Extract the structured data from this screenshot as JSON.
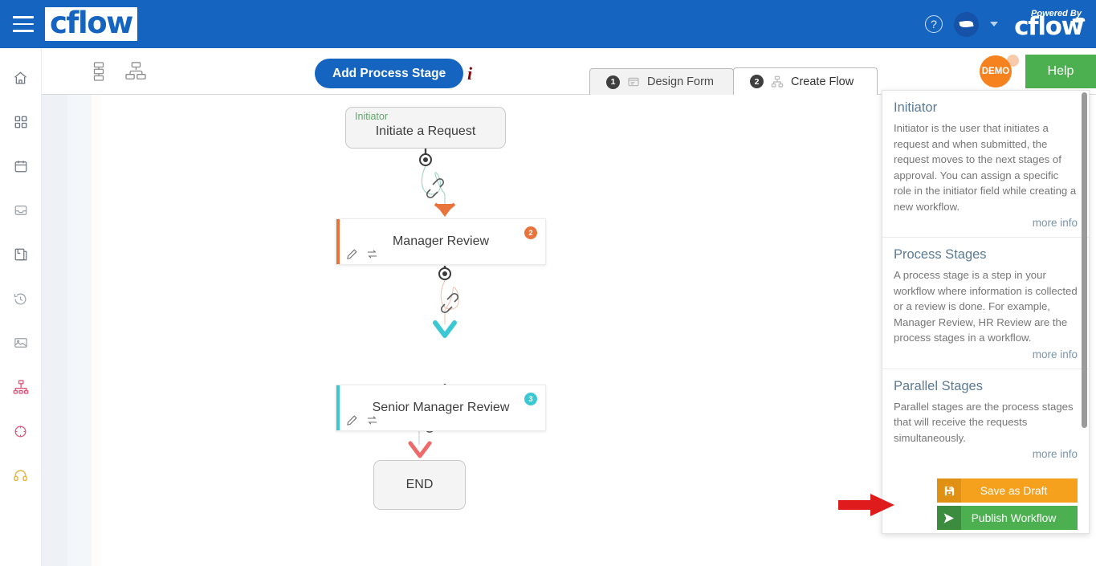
{
  "topbar": {
    "menu_icon": "hamburger-menu-icon",
    "brand": "cflow",
    "help_icon": "question-circle-icon",
    "user_icon": "user-avatar-icon",
    "caret_icon": "chevron-down-icon",
    "powered_by_label": "Powered By",
    "powered_by_brand": "cflow",
    "brand_color": "#1565C0"
  },
  "sidebar": {
    "items": [
      {
        "name": "home",
        "icon": "home-icon",
        "color": "#6b7280"
      },
      {
        "name": "dashboard",
        "icon": "grid-dashboard-icon",
        "color": "#6b7280"
      },
      {
        "name": "calendar",
        "icon": "calendar-icon",
        "color": "#6b7280"
      },
      {
        "name": "inbox",
        "icon": "inbox-tray-icon",
        "color": "#9aa0a6"
      },
      {
        "name": "reports",
        "icon": "document-copy-icon",
        "color": "#6b7280"
      },
      {
        "name": "history",
        "icon": "clock-history-icon",
        "color": "#9aa0a6"
      },
      {
        "name": "gallery",
        "icon": "image-card-icon",
        "color": "#9aa0a6"
      },
      {
        "name": "workflow",
        "icon": "workflow-tree-icon",
        "color": "#e0557a"
      },
      {
        "name": "integrations",
        "icon": "target-gear-icon",
        "color": "#e0557a"
      },
      {
        "name": "support",
        "icon": "headset-icon",
        "color": "#e8b23a"
      }
    ]
  },
  "toolbar": {
    "layout_vertical_icon": "vertical-tree-layout-icon",
    "layout_tree_icon": "branch-tree-layout-icon",
    "add_stage_label": "Add Process Stage",
    "info_icon": "info-italic-icon",
    "tabs": [
      {
        "num": "1",
        "label": "Design Form",
        "icon": "form-icon",
        "active": false
      },
      {
        "num": "2",
        "label": "Create Flow",
        "icon": "flow-icon",
        "active": true
      }
    ],
    "avatar_label": "DEMO",
    "help_label": "Help"
  },
  "workflow": {
    "nodes": [
      {
        "type": "start",
        "tag": "Initiator",
        "tag_color": "#62a66c",
        "title": "Initiate a Request"
      },
      {
        "type": "stage",
        "title": "Manager Review",
        "badge": "2",
        "accent_color": "#E8743B",
        "badge_color": "#E8743B",
        "arrow_color": "#E8743B",
        "edit_icon": "pencil-icon",
        "move_icon": "swap-arrows-icon"
      },
      {
        "type": "stage",
        "title": "Senior Manager Review",
        "badge": "3",
        "accent_color": "#3BC7D4",
        "badge_color": "#3BC7D4",
        "arrow_color": "#3BC7D4",
        "edit_icon": "pencil-icon",
        "move_icon": "swap-arrows-icon"
      },
      {
        "type": "end",
        "title": "END",
        "arrow_color": "#EE6A6A"
      }
    ],
    "connector_icon": "link-chain-icon",
    "connector_port_icon": "port-dot-icon"
  },
  "info_panel": {
    "sections": [
      {
        "title": "Initiator",
        "body": "Initiator is the user that initiates a request and when submitted, the request moves to the next stages of approval. You can assign a specific role in the initiator field while creating a new workflow.",
        "more_info": "more info"
      },
      {
        "title": "Process Stages",
        "body": "A process stage is a step in your workflow where information is collected or a review is done. For example, Manager Review, HR Review are the process stages in a workflow.",
        "more_info": "more info"
      },
      {
        "title": "Parallel Stages",
        "body": "Parallel stages are the process stages that will receive the requests simultaneously.",
        "more_info": "more info"
      }
    ],
    "actions": {
      "save_draft_label": "Save as Draft",
      "save_draft_icon": "floppy-save-icon",
      "save_draft_color": "#F5A11E",
      "publish_label": "Publish Workflow",
      "publish_icon": "send-arrow-icon",
      "publish_color": "#4CAF50"
    },
    "scrollbar": "vertical-scrollbar"
  },
  "annotation": {
    "arrow": "red-pointer-arrow",
    "color": "#E01B1B"
  }
}
